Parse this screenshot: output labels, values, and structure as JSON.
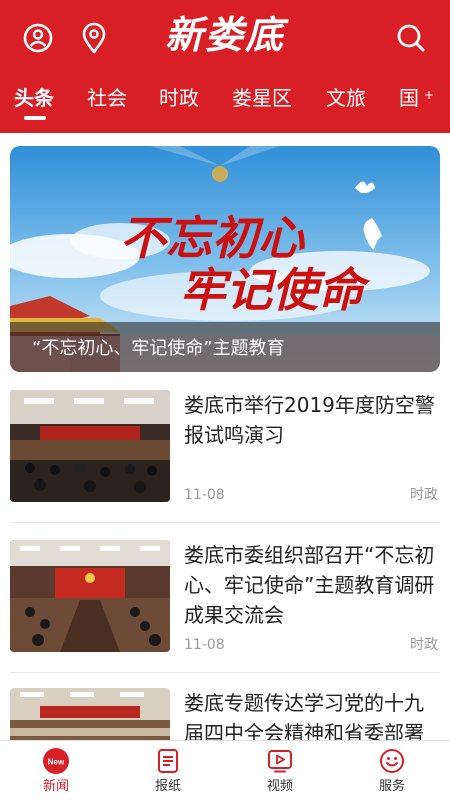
{
  "header": {
    "logo_text": "新娄底",
    "tabs": [
      {
        "label": "头条"
      },
      {
        "label": "社会"
      },
      {
        "label": "时政"
      },
      {
        "label": "娄星区"
      },
      {
        "label": "文旅"
      },
      {
        "label": "国"
      }
    ],
    "more_tabs_symbol": "+"
  },
  "banner": {
    "caption": "“不忘初心、牢记使命”主题教育",
    "artwork_text_line1": "不忘初心",
    "artwork_text_line2": "牢记使命"
  },
  "news": [
    {
      "title": "娄底市举行2019年度防空警报试鸣演习",
      "date": "11-08",
      "category": "时政"
    },
    {
      "title": "娄底市委组织部召开“不忘初心、牢记使命”主题教育调研成果交流会",
      "date": "11-08",
      "category": "时政"
    },
    {
      "title": "娄底专题传达学习党的十九届四中全会精神和省委部署",
      "date": "",
      "category": ""
    }
  ],
  "bottom_nav": [
    {
      "label": "新闻",
      "icon": "news-icon",
      "badge": "New",
      "active": true
    },
    {
      "label": "报纸",
      "icon": "newspaper-icon"
    },
    {
      "label": "视频",
      "icon": "video-icon"
    },
    {
      "label": "服务",
      "icon": "smiley-icon"
    }
  ],
  "colors": {
    "brand_red": "#d91f26",
    "meta_gray": "#999999"
  }
}
